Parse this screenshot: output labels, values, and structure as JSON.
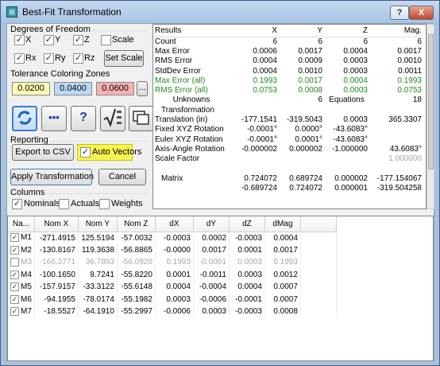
{
  "window": {
    "title": "Best-Fit Transformation",
    "help_label": "?",
    "close_label": "X"
  },
  "dof": {
    "heading": "Degrees of Freedom",
    "x": "X",
    "y": "Y",
    "z": "Z",
    "scale": "Scale",
    "rx": "Rx",
    "ry": "Ry",
    "rz": "Rz",
    "set_scale": "Set Scale"
  },
  "tolerance": {
    "heading": "Tolerance Coloring Zones",
    "z1": "0.0200",
    "z2": "0.0400",
    "z3": "0.0600",
    "more": "..."
  },
  "tools": {
    "b2": "•••",
    "b3": "?"
  },
  "reporting": {
    "heading": "Reporting",
    "export": "Export to CSV",
    "auto_vectors": "Auto Vectors"
  },
  "actions": {
    "apply": "Apply Transformation",
    "cancel": "Cancel"
  },
  "columns": {
    "heading": "Columns",
    "nominals": "Nominals",
    "actuals": "Actuals",
    "weights": "Weights"
  },
  "results": {
    "headers": [
      "Results",
      "X",
      "Y",
      "Z",
      "Mag."
    ],
    "rows": [
      {
        "label": "Count",
        "x": "6",
        "y": "6",
        "z": "6",
        "m": "6"
      },
      {
        "label": "Max Error",
        "x": "0.0006",
        "y": "0.0017",
        "z": "0.0004",
        "m": "0.0017"
      },
      {
        "label": "RMS Error",
        "x": "0.0004",
        "y": "0.0009",
        "z": "0.0003",
        "m": "0.0010"
      },
      {
        "label": "StdDev Error",
        "x": "0.0004",
        "y": "0.0010",
        "z": "0.0003",
        "m": "0.0011"
      },
      {
        "label": "Max Error (all)",
        "x": "0.1993",
        "y": "0.0017",
        "z": "0.0004",
        "m": "0.1993"
      },
      {
        "label": "RMS Error (all)",
        "x": "0.0753",
        "y": "0.0008",
        "z": "0.0003",
        "m": "0.0753"
      }
    ],
    "unknowns_label": "Unknowns",
    "unknowns": "6",
    "equations_label": "Equations",
    "equations": "18",
    "transform_heading": "Transformation",
    "trows": [
      {
        "label": "Translation (in)",
        "x": "-177.1541",
        "y": "-319.5043",
        "z": "0.0003",
        "m": "365.3307"
      },
      {
        "label": "Fixed XYZ Rotation",
        "x": "-0.0001°",
        "y": "0.0000°",
        "z": "-43.6083°",
        "m": ""
      },
      {
        "label": "Euler XYZ Rotation",
        "x": "-0.0001°",
        "y": "0.0001°",
        "z": "-43.6083°",
        "m": ""
      },
      {
        "label": "Axis-Angle Rotation",
        "x": "-0.000002",
        "y": "0.000002",
        "z": "-1.000000",
        "m": "43.6083°"
      }
    ],
    "scale_label": "Scale Factor",
    "scale": "1.000000",
    "matrix_label": "Matrix",
    "matrix": [
      {
        "a": "0.724072",
        "b": "0.689724",
        "c": "0.000002",
        "d": "-177.154067"
      },
      {
        "a": "-0.689724",
        "b": "0.724072",
        "c": "0.000001",
        "d": "-319.504258"
      }
    ]
  },
  "grid": {
    "headers": [
      "Na...",
      "Nom X",
      "Nom Y",
      "Nom Z",
      "dX",
      "dY",
      "dZ",
      "dMag"
    ],
    "rows": [
      {
        "name": "M1",
        "nx": "-271.4915",
        "ny": "125.5194",
        "nz": "-57.0032",
        "dx": "-0.0003",
        "dy": "0.0002",
        "dz": "-0.0003",
        "dm": "0.0004"
      },
      {
        "name": "M2",
        "nx": "-130.8167",
        "ny": "119.3638",
        "nz": "-56.8865",
        "dx": "-0.0000",
        "dy": "0.0017",
        "dz": "0.0001",
        "dm": "0.0017"
      },
      {
        "name": "M3",
        "nx": "-166.3771",
        "ny": "36.7893",
        "nz": "-56.0920",
        "dx": "0.1993",
        "dy": "-0.0001",
        "dz": "0.0003",
        "dm": "0.1993"
      },
      {
        "name": "M4",
        "nx": "-100.1650",
        "ny": "8.7241",
        "nz": "-55.8220",
        "dx": "0.0001",
        "dy": "-0.0011",
        "dz": "0.0003",
        "dm": "0.0012"
      },
      {
        "name": "M5",
        "nx": "-157.9157",
        "ny": "-33.3122",
        "nz": "-55.6148",
        "dx": "0.0004",
        "dy": "-0.0004",
        "dz": "0.0004",
        "dm": "0.0007"
      },
      {
        "name": "M6",
        "nx": "-94.1955",
        "ny": "-78.0174",
        "nz": "-55.1982",
        "dx": "0.0003",
        "dy": "-0.0006",
        "dz": "-0.0001",
        "dm": "0.0007"
      },
      {
        "name": "M7",
        "nx": "-18.5527",
        "ny": "-64.1910",
        "nz": "-55.2997",
        "dx": "-0.0006",
        "dy": "0.0003",
        "dz": "-0.0003",
        "dm": "0.0008"
      }
    ]
  },
  "colors": {
    "zone1": "#ffffb4",
    "zone2": "#b9d9f5",
    "zone3": "#f5b1b1",
    "highlight": "#f5f550",
    "green": "#1e8a1e"
  }
}
